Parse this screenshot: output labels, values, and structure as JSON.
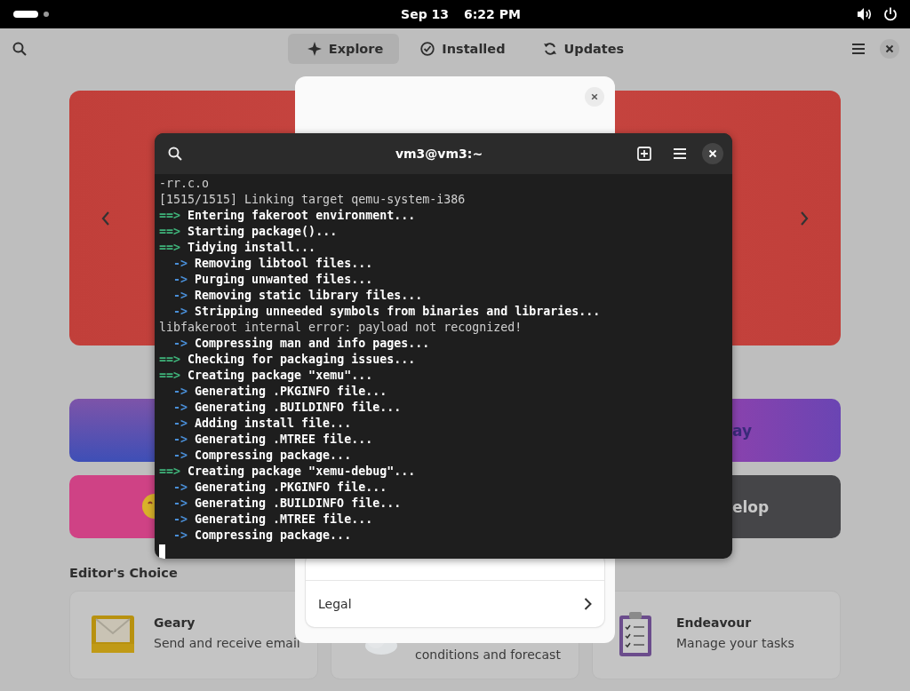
{
  "top_bar": {
    "date": "Sep 13",
    "time": "6:22 PM"
  },
  "header": {
    "tabs": [
      {
        "label": "Explore",
        "selected": true
      },
      {
        "label": "Installed",
        "selected": false
      },
      {
        "label": "Updates",
        "selected": false
      }
    ]
  },
  "category_tiles": [
    {
      "kind": "blue"
    },
    {
      "kind": "violet",
      "label": "ay"
    },
    {
      "kind": "pink"
    },
    {
      "kind": "dark",
      "label": "elop"
    }
  ],
  "editors_choice": {
    "heading": "Editor's Choice",
    "apps": [
      {
        "name": "Geary",
        "description": "Send and receive email"
      },
      {
        "description": "conditions and forecast"
      },
      {
        "name": "Endeavour",
        "description": "Manage your tasks"
      }
    ]
  },
  "dialog": {
    "rows": [
      {
        "label": "Legal"
      }
    ]
  },
  "terminal": {
    "title": "vm3@vm3:~",
    "lines": [
      {
        "kind": "plain",
        "text": "-rr.c.o"
      },
      {
        "kind": "plain",
        "text": "[1515/1515] Linking target qemu-system-i386"
      },
      {
        "kind": "step",
        "marker": "==>",
        "text": "Entering fakeroot environment..."
      },
      {
        "kind": "step",
        "marker": "==>",
        "text": "Starting package()..."
      },
      {
        "kind": "step",
        "marker": "==>",
        "text": "Tidying install..."
      },
      {
        "kind": "substep",
        "marker": "->",
        "text": "Removing libtool files..."
      },
      {
        "kind": "substep",
        "marker": "->",
        "text": "Purging unwanted files..."
      },
      {
        "kind": "substep",
        "marker": "->",
        "text": "Removing static library files..."
      },
      {
        "kind": "substep",
        "marker": "->",
        "text": "Stripping unneeded symbols from binaries and libraries..."
      },
      {
        "kind": "plain",
        "text": "libfakeroot internal error: payload not recognized!"
      },
      {
        "kind": "substep",
        "marker": "->",
        "text": "Compressing man and info pages..."
      },
      {
        "kind": "step",
        "marker": "==>",
        "text": "Checking for packaging issues..."
      },
      {
        "kind": "step",
        "marker": "==>",
        "text": "Creating package \"xemu\"..."
      },
      {
        "kind": "substep",
        "marker": "->",
        "text": "Generating .PKGINFO file..."
      },
      {
        "kind": "substep",
        "marker": "->",
        "text": "Generating .BUILDINFO file..."
      },
      {
        "kind": "substep",
        "marker": "->",
        "text": "Adding install file..."
      },
      {
        "kind": "substep",
        "marker": "->",
        "text": "Generating .MTREE file..."
      },
      {
        "kind": "substep",
        "marker": "->",
        "text": "Compressing package..."
      },
      {
        "kind": "step",
        "marker": "==>",
        "text": "Creating package \"xemu-debug\"..."
      },
      {
        "kind": "substep",
        "marker": "->",
        "text": "Generating .PKGINFO file..."
      },
      {
        "kind": "substep",
        "marker": "->",
        "text": "Generating .BUILDINFO file..."
      },
      {
        "kind": "substep",
        "marker": "->",
        "text": "Generating .MTREE file..."
      },
      {
        "kind": "substep",
        "marker": "->",
        "text": "Compressing package..."
      },
      {
        "kind": "cursor"
      }
    ]
  }
}
